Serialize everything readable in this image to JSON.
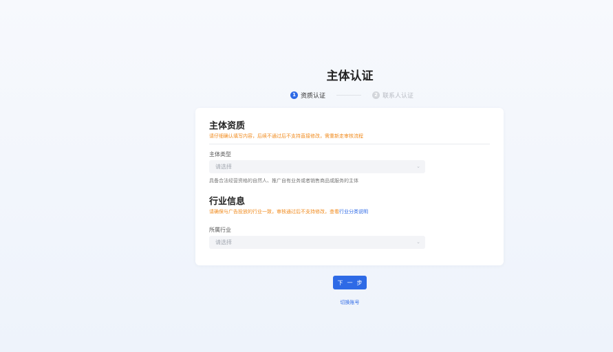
{
  "page": {
    "title": "主体认证"
  },
  "steps": [
    {
      "num": "1",
      "label": "资质认证",
      "state": "active"
    },
    {
      "num": "2",
      "label": "联系人认证",
      "state": "inactive"
    }
  ],
  "qualification": {
    "title": "主体资质",
    "warning": "请仔细确认填写内容，后续不通过后不支持直接修改，需重新走审核流程",
    "subject_type": {
      "label": "主体类型",
      "placeholder": "请选择",
      "hint": "具备合法经营资格的自然人、推广自有业务或者销售商品或服务的主体"
    }
  },
  "industry": {
    "title": "行业信息",
    "warning": "请确保与广告投放的行业一致，审核通过后不支持修改，查看",
    "warning_link": "行业分类说明",
    "field": {
      "label": "所属行业",
      "placeholder": "请选择"
    }
  },
  "actions": {
    "next_label": "下一步",
    "switch_label": "切换账号"
  },
  "colors": {
    "primary": "#2e6ae6",
    "warning": "#f08a1c"
  }
}
